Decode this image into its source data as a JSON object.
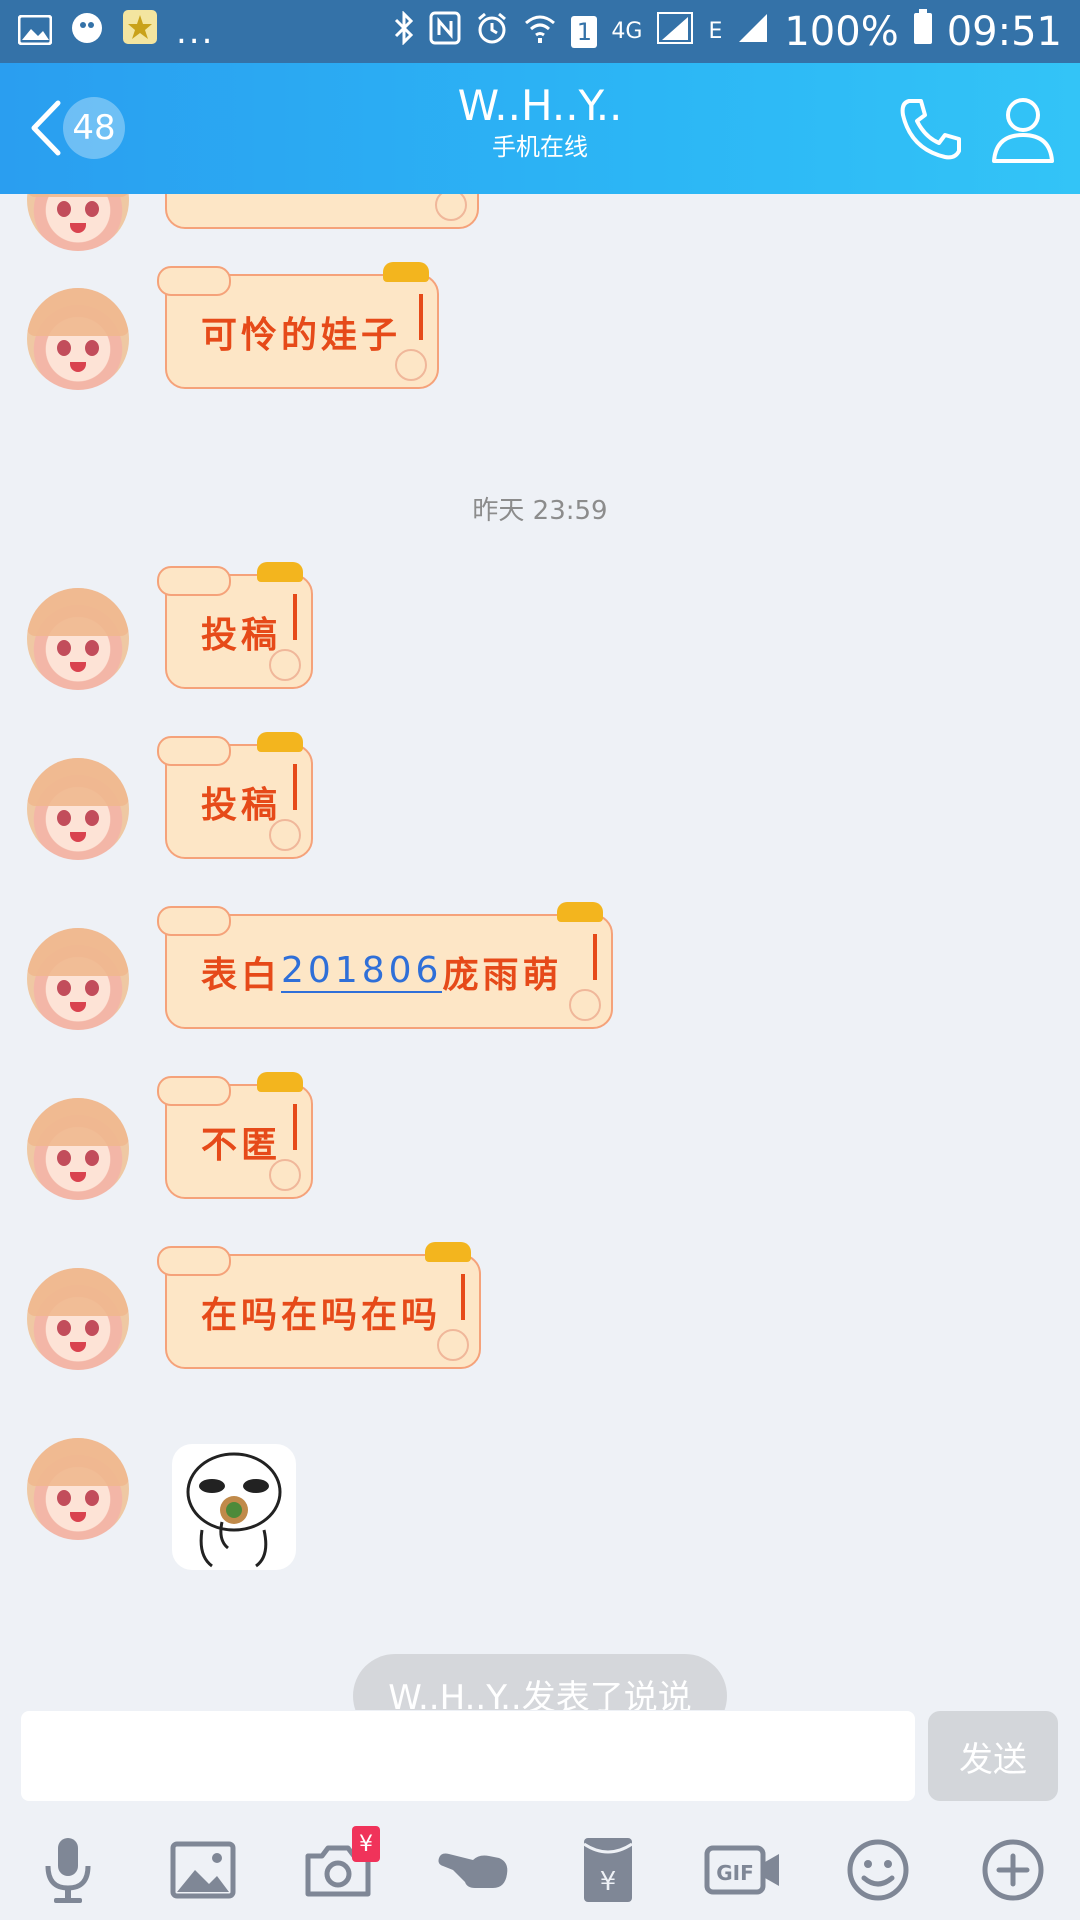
{
  "status_bar": {
    "dots": "...",
    "net_4g": "4G",
    "net_e": "E",
    "sim_slot": "1",
    "battery": "100%",
    "time": "09:51"
  },
  "header": {
    "unread_count": "48",
    "title": "W..H..Y..",
    "subtitle": "手机在线"
  },
  "messages": [
    {
      "text": "可怜的娃子"
    },
    {
      "divider": "昨天 23:59"
    },
    {
      "text": "投稿"
    },
    {
      "text": "投稿"
    },
    {
      "text_prefix": "表白",
      "link": "201806",
      "text_suffix": "庞雨萌"
    },
    {
      "text": "不匿"
    },
    {
      "text": "在吗在吗在吗"
    }
  ],
  "feed_notice": "W..H..Y..发表了说说",
  "input": {
    "value": "",
    "send_label": "发送"
  },
  "toolbar": {
    "red_packet_badge": "¥",
    "items": [
      "mic-icon",
      "image-icon",
      "camera-icon",
      "poke-icon",
      "red-packet-icon",
      "gif-icon",
      "emoji-icon",
      "plus-icon"
    ]
  },
  "colors": {
    "header_start": "#2a9ef0",
    "header_end": "#33c4f7",
    "bubble_bg": "#fde6c6",
    "bubble_text": "#e64a19",
    "link": "#2f6fd8"
  }
}
